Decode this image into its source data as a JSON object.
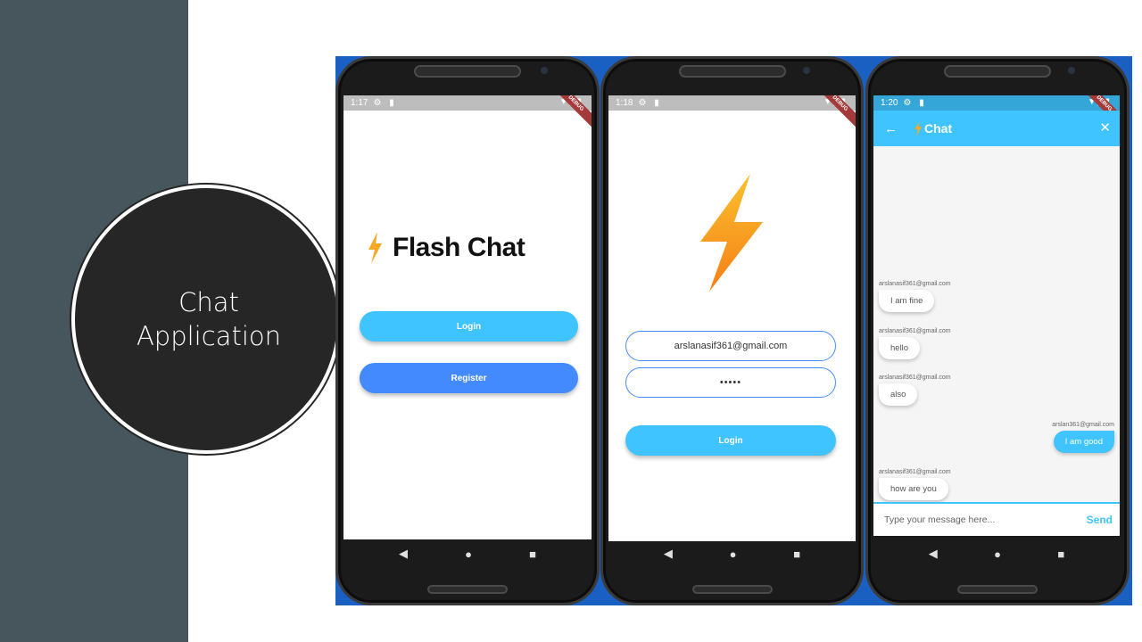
{
  "slide": {
    "title_line1": "Chat",
    "title_line2": "Application",
    "sidebar_color": "#47565c",
    "circle_color": "#262626"
  },
  "phone1": {
    "status": {
      "time": "1:17",
      "left_icons": "⚙ ▮",
      "right_icons": "▼◢▮"
    },
    "debug_banner": "DEBUG",
    "logo_text": "Flash Chat",
    "logo_icon": "lightning-bolt-icon",
    "login_label": "Login",
    "register_label": "Register",
    "login_color": "#40c4ff",
    "register_color": "#448aff",
    "nav": [
      "◀",
      "●",
      "■"
    ]
  },
  "phone2": {
    "status": {
      "time": "1:18",
      "left_icons": "⚙ ▮",
      "right_icons": "▼◢▮"
    },
    "debug_banner": "DEBUG",
    "logo_icon": "lightning-bolt-icon",
    "email_value": "arslanasif361@gmail.com",
    "password_value": "•••••",
    "login_label": "Login",
    "nav": [
      "◀",
      "●",
      "■"
    ]
  },
  "phone3": {
    "status": {
      "time": "1:20",
      "left_icons": "⚙ ▮",
      "right_icons": "▼◢▮"
    },
    "debug_banner": "DEBUG",
    "appbar": {
      "back_icon": "←",
      "title": "Chat",
      "close_icon": "✕"
    },
    "messages": [
      {
        "sender": "arslanasif361@gmail.com",
        "text": "I am fine",
        "mine": false
      },
      {
        "sender": "arslanasif361@gmail.com",
        "text": "hello",
        "mine": false
      },
      {
        "sender": "arslanasif361@gmail.com",
        "text": "also",
        "mine": false
      },
      {
        "sender": "arslan361@gmail.com",
        "text": "I am good",
        "mine": true
      },
      {
        "sender": "arslanasif361@gmail.com",
        "text": "how are you",
        "mine": false
      }
    ],
    "composer": {
      "placeholder": "Type your message here...",
      "send_label": "Send"
    },
    "accent_color": "#40c4ff",
    "nav": [
      "◀",
      "●",
      "■"
    ]
  }
}
